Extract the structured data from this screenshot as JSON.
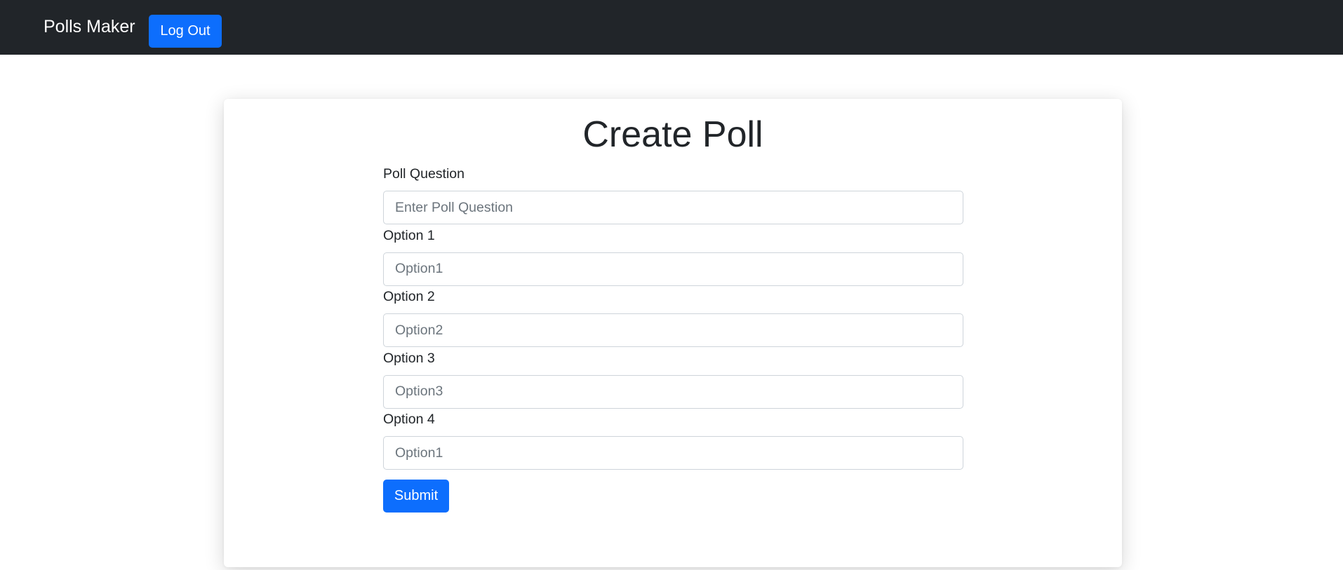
{
  "navbar": {
    "brand": "Polls Maker",
    "logout_label": "Log Out",
    "background": "#212529"
  },
  "card": {
    "title": "Create Poll",
    "fields": [
      {
        "label": "Poll Question",
        "placeholder": "Enter Poll Question",
        "value": ""
      },
      {
        "label": "Option 1",
        "placeholder": "Option1",
        "value": ""
      },
      {
        "label": "Option 2",
        "placeholder": "Option2",
        "value": ""
      },
      {
        "label": "Option 3",
        "placeholder": "Option3",
        "value": ""
      },
      {
        "label": "Option 4",
        "placeholder": "Option1",
        "value": ""
      }
    ],
    "submit_label": "Submit"
  },
  "colors": {
    "primary": "#0d6efd",
    "text": "#212529",
    "placeholder": "#6c757d",
    "input_border": "#ced4da"
  }
}
